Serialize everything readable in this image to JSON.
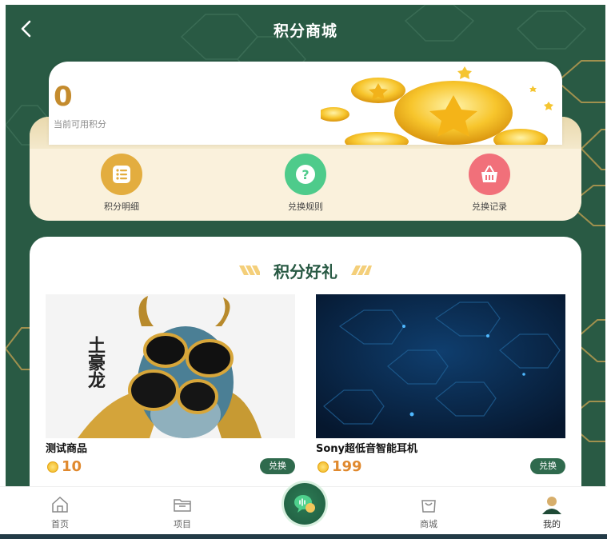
{
  "header": {
    "title": "积分商城"
  },
  "points": {
    "value": "0",
    "label": "当前可用积分"
  },
  "actions": [
    {
      "label": "积分明细",
      "icon": "list-icon",
      "color": "#e3ad3f"
    },
    {
      "label": "兑换规则",
      "icon": "question-icon",
      "color": "#4ecb8b"
    },
    {
      "label": "兑换记录",
      "icon": "basket-icon",
      "color": "#f1707a"
    }
  ],
  "gifts": {
    "title": "积分好礼",
    "products": [
      {
        "name": "测试商品",
        "price": "10",
        "image_text": "土豪龙",
        "button": "兑换"
      },
      {
        "name": "Sony超低音智能耳机",
        "price": "199",
        "button": "兑换"
      }
    ]
  },
  "tabbar": {
    "items": [
      {
        "label": "首页",
        "icon": "home-icon"
      },
      {
        "label": "项目",
        "icon": "folder-icon"
      },
      {
        "label": "商城",
        "icon": "shopping-bag-icon"
      },
      {
        "label": "我的",
        "icon": "user-icon"
      }
    ],
    "center_icon": "chat-icon",
    "active": "我的"
  },
  "colors": {
    "background": "#295a44",
    "accent": "#c48b2d",
    "button": "#2f6a4d"
  }
}
